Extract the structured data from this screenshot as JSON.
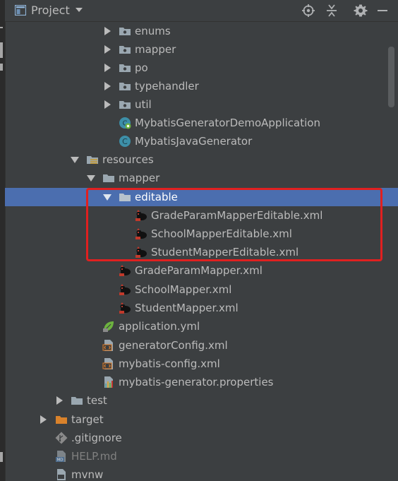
{
  "header": {
    "title": "Project",
    "icons": [
      "project-view-icon",
      "dropdown-caret-icon",
      "locate-icon",
      "collapse-all-icon",
      "settings-gear-icon",
      "hide-minimize-icon"
    ]
  },
  "tree": {
    "items": [
      {
        "label": "enums",
        "icon": "package-folder-icon",
        "expanded": false
      },
      {
        "label": "mapper",
        "icon": "package-folder-icon",
        "expanded": false
      },
      {
        "label": "po",
        "icon": "package-folder-icon",
        "expanded": false
      },
      {
        "label": "typehandler",
        "icon": "package-folder-icon",
        "expanded": false
      },
      {
        "label": "util",
        "icon": "package-folder-icon",
        "expanded": false
      },
      {
        "label": "MybatisGeneratorDemoApplication",
        "icon": "spring-boot-class-icon"
      },
      {
        "label": "MybatisJavaGenerator",
        "icon": "java-class-icon"
      },
      {
        "label": "resources",
        "icon": "resources-folder-icon",
        "expanded": true
      },
      {
        "label": "mapper",
        "icon": "folder-icon",
        "expanded": true
      },
      {
        "label": "editable",
        "icon": "folder-icon",
        "expanded": true,
        "selected": true
      },
      {
        "label": "GradeParamMapperEditable.xml",
        "icon": "mybatis-xml-icon"
      },
      {
        "label": "SchoolMapperEditable.xml",
        "icon": "mybatis-xml-icon"
      },
      {
        "label": "StudentMapperEditable.xml",
        "icon": "mybatis-xml-icon"
      },
      {
        "label": "GradeParamMapper.xml",
        "icon": "mybatis-xml-icon"
      },
      {
        "label": "SchoolMapper.xml",
        "icon": "mybatis-xml-icon"
      },
      {
        "label": "StudentMapper.xml",
        "icon": "mybatis-xml-icon"
      },
      {
        "label": "application.yml",
        "icon": "spring-leaf-icon"
      },
      {
        "label": "generatorConfig.xml",
        "icon": "xml-file-icon"
      },
      {
        "label": "mybatis-config.xml",
        "icon": "xml-file-icon"
      },
      {
        "label": "mybatis-generator.properties",
        "icon": "properties-file-icon"
      },
      {
        "label": "test",
        "icon": "folder-icon",
        "expanded": false
      },
      {
        "label": "target",
        "icon": "excluded-folder-icon",
        "expanded": false
      },
      {
        "label": ".gitignore",
        "icon": "git-ignore-icon"
      },
      {
        "label": "HELP.md",
        "icon": "markdown-file-icon"
      },
      {
        "label": "mvnw",
        "icon": "shell-file-icon"
      }
    ]
  },
  "colors": {
    "background": "#3c3f41",
    "selection": "#4b6eaf",
    "text": "#bbbbbb",
    "muted_text": "#808080",
    "annotation_box": "#e02020"
  }
}
